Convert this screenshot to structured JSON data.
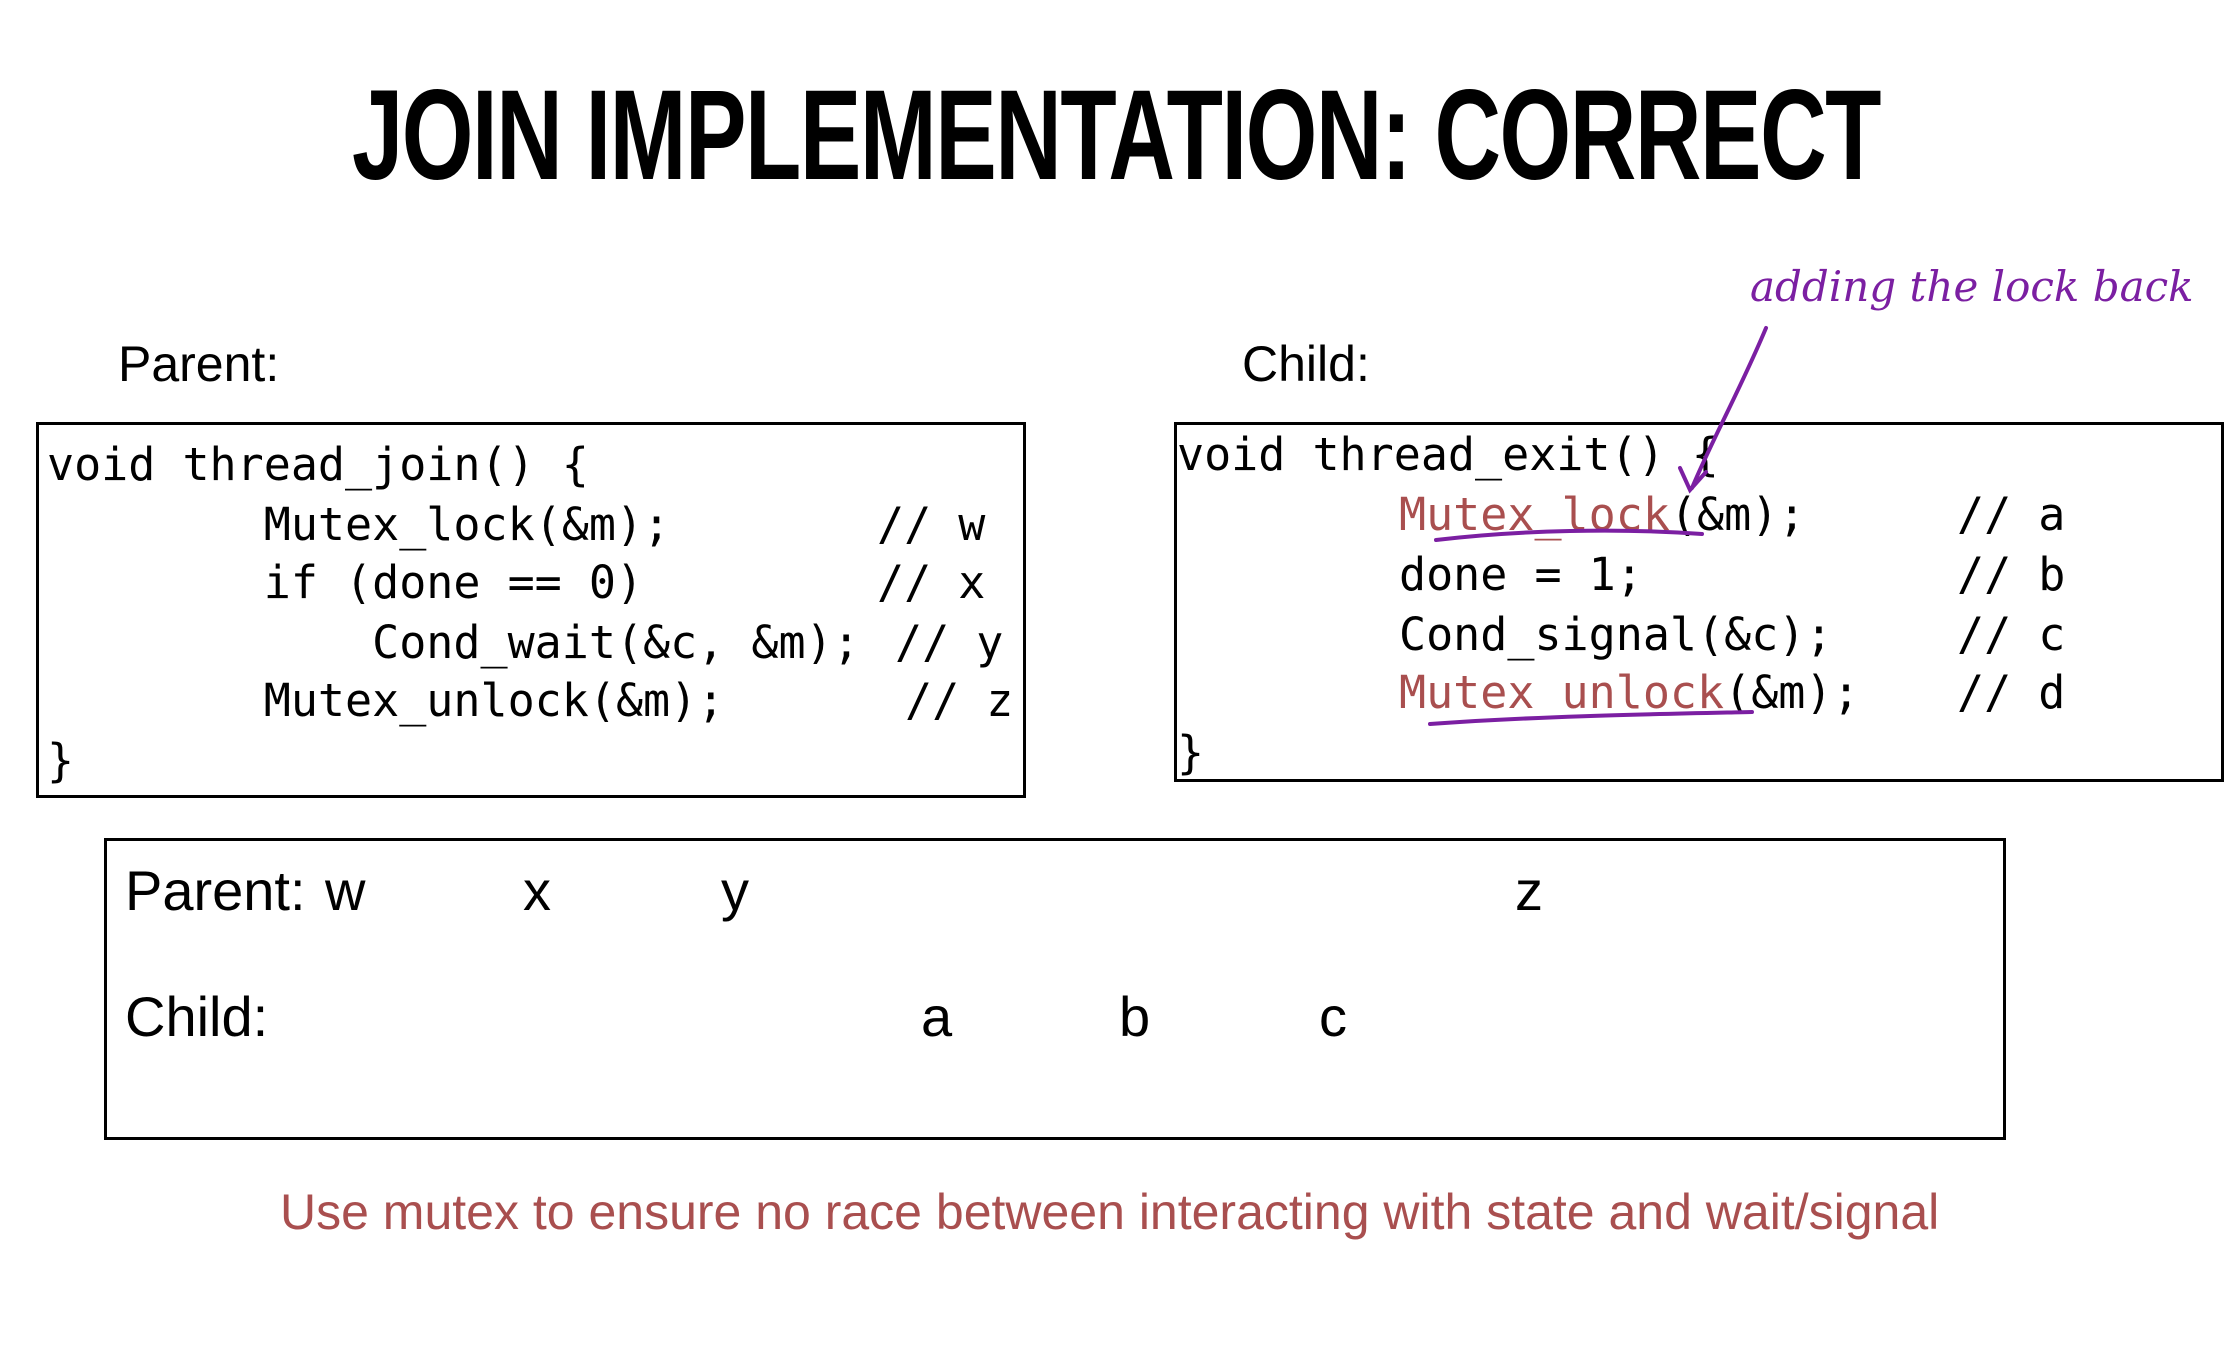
{
  "title": "JOIN IMPLEMENTATION: CORRECT",
  "parent_label": "Parent:",
  "child_label": "Child:",
  "parent_code": {
    "lines": [
      "void thread_join() {",
      "        Mutex_lock(&m);",
      "        if (done == 0)",
      "            Cond_wait(&c, &m);",
      "        Mutex_unlock(&m);",
      "}"
    ],
    "comments": [
      "// w",
      "// x",
      "// y",
      "// z"
    ]
  },
  "child_code": {
    "line0": "void thread_exit() {",
    "line1_fn": "Mutex_lock",
    "line1_rest": "(&m);",
    "line2": "done = 1;",
    "line3": "Cond_signal(&c);",
    "line4_fn": "Mutex_unlock",
    "line4_rest": "(&m);",
    "line5": "}",
    "comments": [
      "// a",
      "// b",
      "// c",
      "// d"
    ]
  },
  "annotation": "adding the lock back",
  "sequence": {
    "parent_label": "Parent:",
    "child_label": "Child:",
    "parent_steps": [
      "w",
      "x",
      "y",
      "z"
    ],
    "child_steps": [
      "a",
      "b",
      "c"
    ]
  },
  "footer": "Use mutex to ensure no race between interacting with state and wait/signal",
  "colors": {
    "highlight": "#a94f4f",
    "ink": "#7b1fa2"
  }
}
